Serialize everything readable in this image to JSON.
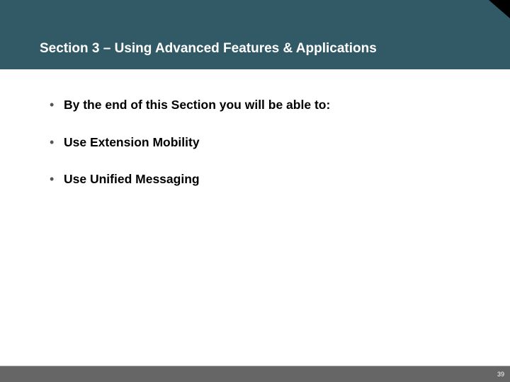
{
  "header": {
    "title": "Section 3 – Using Advanced Features & Applications"
  },
  "bullets": {
    "items": [
      "By the end of this Section you will be able to:",
      "Use Extension Mobility",
      "Use Unified Messaging"
    ]
  },
  "footer": {
    "page_number": "39"
  }
}
